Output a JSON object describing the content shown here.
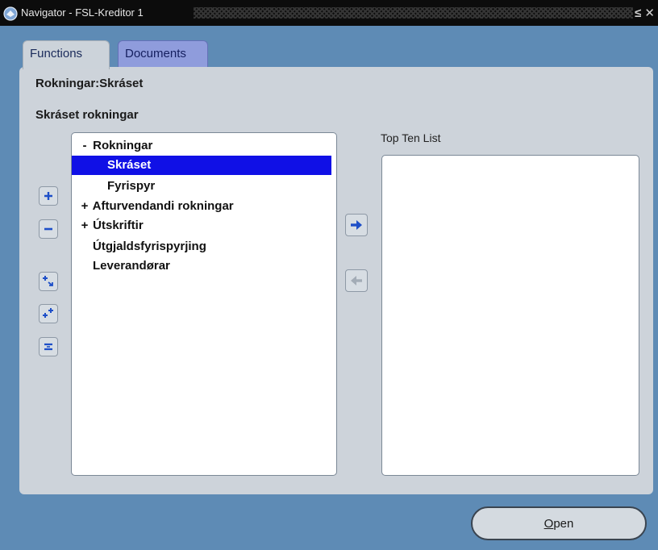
{
  "window": {
    "title": "Navigator - FSL-Kreditor 1",
    "controls": "≤ ✕"
  },
  "tabs": [
    {
      "label": "Functions",
      "active": true
    },
    {
      "label": "Documents",
      "active": false
    }
  ],
  "panel": {
    "path_label": "Rokningar:Skráset",
    "description": "Skráset rokningar"
  },
  "tree": {
    "items": [
      {
        "label": "Rokningar",
        "expander": "-",
        "level": 0,
        "selected": false
      },
      {
        "label": "Skráset",
        "expander": "",
        "level": 1,
        "selected": true
      },
      {
        "label": "Fyrispyr",
        "expander": "",
        "level": 1,
        "selected": false
      },
      {
        "label": "Afturvendandi rokningar",
        "expander": "+",
        "level": 0,
        "selected": false
      },
      {
        "label": "Útskriftir",
        "expander": "+",
        "level": 0,
        "selected": false
      },
      {
        "label": "Útgjaldsfyrispyrjing",
        "expander": "",
        "level": 0,
        "selected": false
      },
      {
        "label": "Leverandørar",
        "expander": "",
        "level": 0,
        "selected": false
      }
    ]
  },
  "side_buttons": [
    "expand-icon",
    "collapse-icon",
    "expand-branch-icon",
    "expand-all-icon",
    "collapse-all-icon"
  ],
  "transfer_buttons": [
    "arrow-right-icon",
    "arrow-left-icon"
  ],
  "top_ten": {
    "label": "Top Ten List",
    "items": []
  },
  "actions": {
    "open_mnemonic": "O",
    "open_rest": "pen"
  },
  "colors": {
    "selection": "#1010e6",
    "background": "#5e8bb5",
    "panel": "#cdd3da"
  }
}
